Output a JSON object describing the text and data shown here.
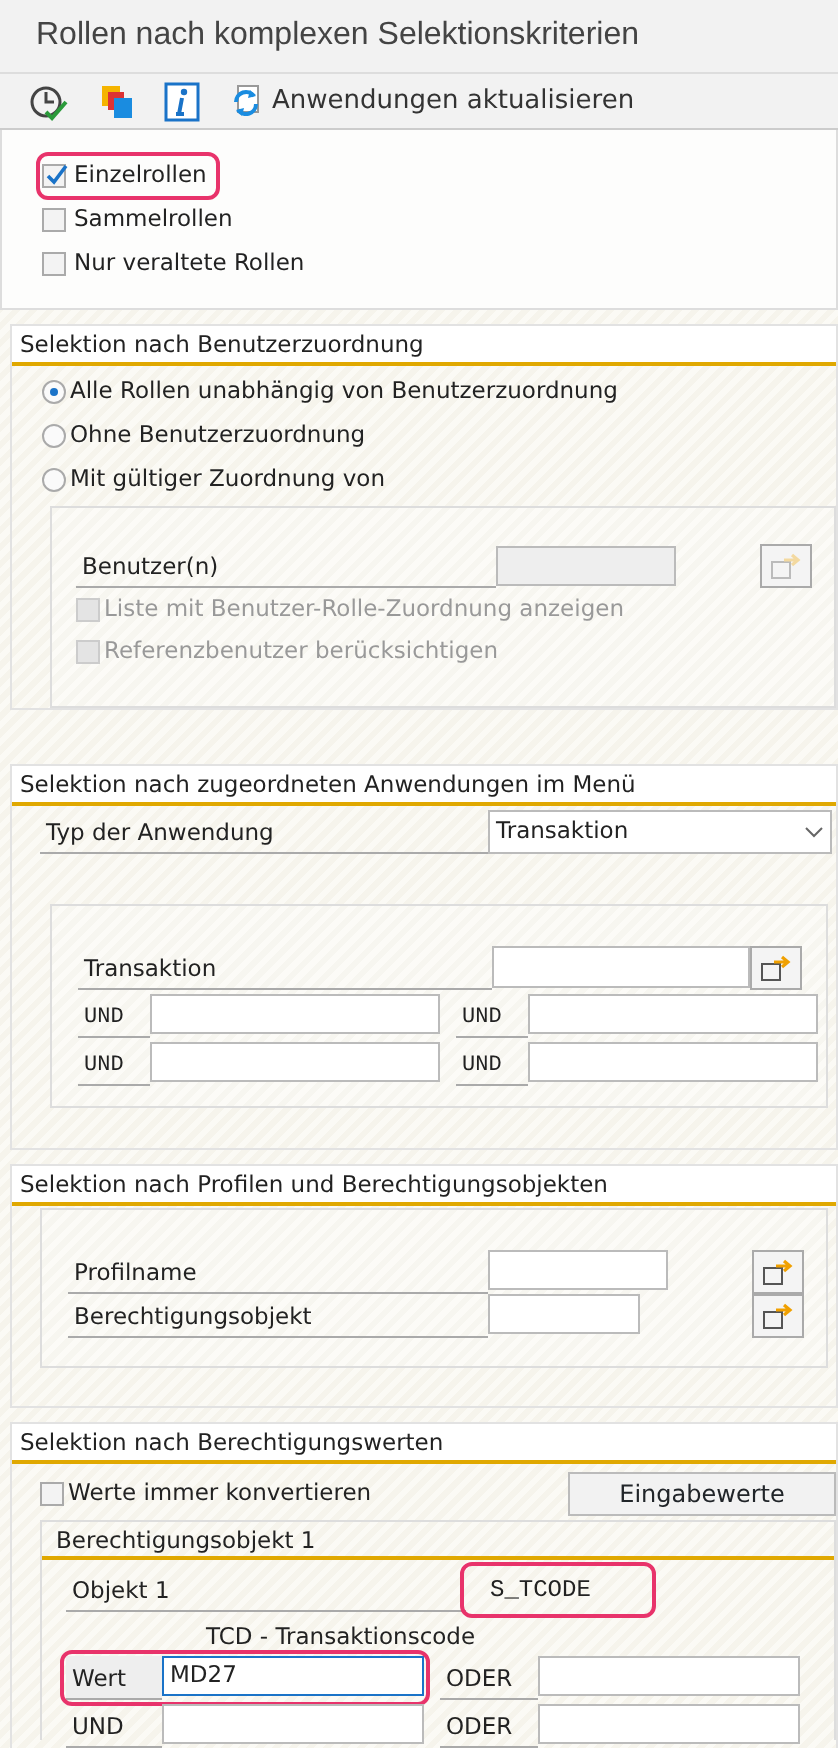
{
  "window": {
    "title": "Rollen nach komplexen Selektionskriterien"
  },
  "toolbar": [
    {
      "kind": "execute"
    },
    {
      "kind": "copy"
    },
    {
      "kind": "info"
    },
    {
      "kind": "refresh",
      "label": "Anwendungen aktualisieren"
    }
  ],
  "role_types": [
    {
      "label": "Einzelrollen",
      "checked": true,
      "highlighted": true
    },
    {
      "label": "Sammelrollen",
      "checked": false,
      "highlighted": false
    },
    {
      "label": "Nur veraltete Rollen",
      "checked": false,
      "highlighted": false
    }
  ],
  "user_assignment": {
    "title": "Selektion nach Benutzerzuordnung",
    "options": [
      {
        "label": "Alle Rollen unabhängig von Benutzerzuordnung",
        "selected": true
      },
      {
        "label": "Ohne Benutzerzuordnung",
        "selected": false
      },
      {
        "label": "Mit gültiger Zuordnung von",
        "selected": false
      }
    ],
    "users_label": "Benutzer(n)",
    "users_disabled": true,
    "checks": [
      {
        "label": "Liste mit Benutzer-Rolle-Zuordnung anzeigen",
        "checked": false,
        "disabled": true
      },
      {
        "label": "Referenzbenutzer berücksichtigen",
        "checked": false,
        "disabled": true
      }
    ]
  },
  "applications": {
    "title": "Selektion nach zugeordneten Anwendungen im Menü",
    "type_label": "Typ der Anwendung",
    "type_value": "Transaktion",
    "field_label": "Transaktion",
    "and_rows": [
      [
        {
          "label": "UND"
        },
        {
          "label": "UND"
        }
      ],
      [
        {
          "label": "UND"
        },
        {
          "label": "UND"
        }
      ]
    ]
  },
  "profiles": {
    "title": "Selektion nach Profilen und Berechtigungsobjekten",
    "fields": [
      {
        "label": "Profilname"
      },
      {
        "label": "Berechtigungsobjekt"
      }
    ]
  },
  "values": {
    "title": "Selektion nach Berechtigungswerten",
    "convert": {
      "label": "Werte immer konvertieren",
      "checked": false
    },
    "button": "Eingabewerte",
    "group": {
      "title": "Berechtigungsobjekt 1",
      "object_label": "Objekt 1",
      "object_value": "S_TCODE",
      "object_highlighted": true,
      "field_title": "TCD - Transaktionscode",
      "rows": [
        {
          "label": "Wert",
          "value": "MD27",
          "highlighted": true,
          "focused": true,
          "or_label": "ODER"
        },
        {
          "label": "UND",
          "highlighted": false,
          "focused": false,
          "or_label": "ODER"
        }
      ]
    }
  }
}
